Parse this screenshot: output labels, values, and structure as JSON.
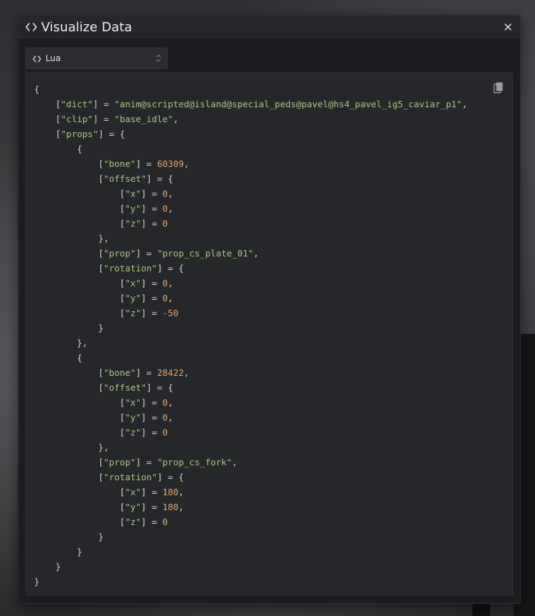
{
  "dialog": {
    "title": "Visualize Data",
    "close_label": "×"
  },
  "language_select": {
    "selected": "Lua"
  },
  "code_lines": [
    [
      [
        "p",
        "{"
      ]
    ],
    [
      [
        "p",
        "    ["
      ],
      [
        "k",
        "\"dict\""
      ],
      [
        "p",
        "] = "
      ],
      [
        "s",
        "\"anim@scripted@island@special_peds@pavel@hs4_pavel_ig5_caviar_p1\""
      ],
      [
        "p",
        ","
      ]
    ],
    [
      [
        "p",
        "    ["
      ],
      [
        "k",
        "\"clip\""
      ],
      [
        "p",
        "] = "
      ],
      [
        "s",
        "\"base_idle\""
      ],
      [
        "p",
        ","
      ]
    ],
    [
      [
        "p",
        "    ["
      ],
      [
        "k",
        "\"props\""
      ],
      [
        "p",
        "] = {"
      ]
    ],
    [
      [
        "p",
        "        {"
      ]
    ],
    [
      [
        "p",
        "            ["
      ],
      [
        "k",
        "\"bone\""
      ],
      [
        "p",
        "] = "
      ],
      [
        "n",
        "60309"
      ],
      [
        "p",
        ","
      ]
    ],
    [
      [
        "p",
        "            ["
      ],
      [
        "k",
        "\"offset\""
      ],
      [
        "p",
        "] = {"
      ]
    ],
    [
      [
        "p",
        "                ["
      ],
      [
        "k",
        "\"x\""
      ],
      [
        "p",
        "] = "
      ],
      [
        "n",
        "0"
      ],
      [
        "p",
        ","
      ]
    ],
    [
      [
        "p",
        "                ["
      ],
      [
        "k",
        "\"y\""
      ],
      [
        "p",
        "] = "
      ],
      [
        "n",
        "0"
      ],
      [
        "p",
        ","
      ]
    ],
    [
      [
        "p",
        "                ["
      ],
      [
        "k",
        "\"z\""
      ],
      [
        "p",
        "] = "
      ],
      [
        "n",
        "0"
      ]
    ],
    [
      [
        "p",
        "            },"
      ]
    ],
    [
      [
        "p",
        "            ["
      ],
      [
        "k",
        "\"prop\""
      ],
      [
        "p",
        "] = "
      ],
      [
        "s",
        "\"prop_cs_plate_01\""
      ],
      [
        "p",
        ","
      ]
    ],
    [
      [
        "p",
        "            ["
      ],
      [
        "k",
        "\"rotation\""
      ],
      [
        "p",
        "] = {"
      ]
    ],
    [
      [
        "p",
        "                ["
      ],
      [
        "k",
        "\"x\""
      ],
      [
        "p",
        "] = "
      ],
      [
        "n",
        "0"
      ],
      [
        "p",
        ","
      ]
    ],
    [
      [
        "p",
        "                ["
      ],
      [
        "k",
        "\"y\""
      ],
      [
        "p",
        "] = "
      ],
      [
        "n",
        "0"
      ],
      [
        "p",
        ","
      ]
    ],
    [
      [
        "p",
        "                ["
      ],
      [
        "k",
        "\"z\""
      ],
      [
        "p",
        "] = "
      ],
      [
        "n",
        "-50"
      ]
    ],
    [
      [
        "p",
        "            }"
      ]
    ],
    [
      [
        "p",
        "        },"
      ]
    ],
    [
      [
        "p",
        "        {"
      ]
    ],
    [
      [
        "p",
        "            ["
      ],
      [
        "k",
        "\"bone\""
      ],
      [
        "p",
        "] = "
      ],
      [
        "n",
        "28422"
      ],
      [
        "p",
        ","
      ]
    ],
    [
      [
        "p",
        "            ["
      ],
      [
        "k",
        "\"offset\""
      ],
      [
        "p",
        "] = {"
      ]
    ],
    [
      [
        "p",
        "                ["
      ],
      [
        "k",
        "\"x\""
      ],
      [
        "p",
        "] = "
      ],
      [
        "n",
        "0"
      ],
      [
        "p",
        ","
      ]
    ],
    [
      [
        "p",
        "                ["
      ],
      [
        "k",
        "\"y\""
      ],
      [
        "p",
        "] = "
      ],
      [
        "n",
        "0"
      ],
      [
        "p",
        ","
      ]
    ],
    [
      [
        "p",
        "                ["
      ],
      [
        "k",
        "\"z\""
      ],
      [
        "p",
        "] = "
      ],
      [
        "n",
        "0"
      ]
    ],
    [
      [
        "p",
        "            },"
      ]
    ],
    [
      [
        "p",
        "            ["
      ],
      [
        "k",
        "\"prop\""
      ],
      [
        "p",
        "] = "
      ],
      [
        "s",
        "\"prop_cs_fork\""
      ],
      [
        "p",
        ","
      ]
    ],
    [
      [
        "p",
        "            ["
      ],
      [
        "k",
        "\"rotation\""
      ],
      [
        "p",
        "] = {"
      ]
    ],
    [
      [
        "p",
        "                ["
      ],
      [
        "k",
        "\"x\""
      ],
      [
        "p",
        "] = "
      ],
      [
        "n",
        "180"
      ],
      [
        "p",
        ","
      ]
    ],
    [
      [
        "p",
        "                ["
      ],
      [
        "k",
        "\"y\""
      ],
      [
        "p",
        "] = "
      ],
      [
        "n",
        "180"
      ],
      [
        "p",
        ","
      ]
    ],
    [
      [
        "p",
        "                ["
      ],
      [
        "k",
        "\"z\""
      ],
      [
        "p",
        "] = "
      ],
      [
        "n",
        "0"
      ]
    ],
    [
      [
        "p",
        "            }"
      ]
    ],
    [
      [
        "p",
        "        }"
      ]
    ],
    [
      [
        "p",
        "    }"
      ]
    ],
    [
      [
        "p",
        "}"
      ]
    ]
  ],
  "icons": {
    "header": "code-icon",
    "close": "close-icon",
    "language": "code-icon",
    "chevron": "chevron-updown-icon",
    "copy": "copy-icon"
  },
  "colors": {
    "dialog_bg": "#1c1d20",
    "header_bg": "#25262a",
    "code_bg": "#26272b",
    "string": "#a8c97f",
    "number": "#e5a46a",
    "punctuation": "#d6d6d6"
  }
}
